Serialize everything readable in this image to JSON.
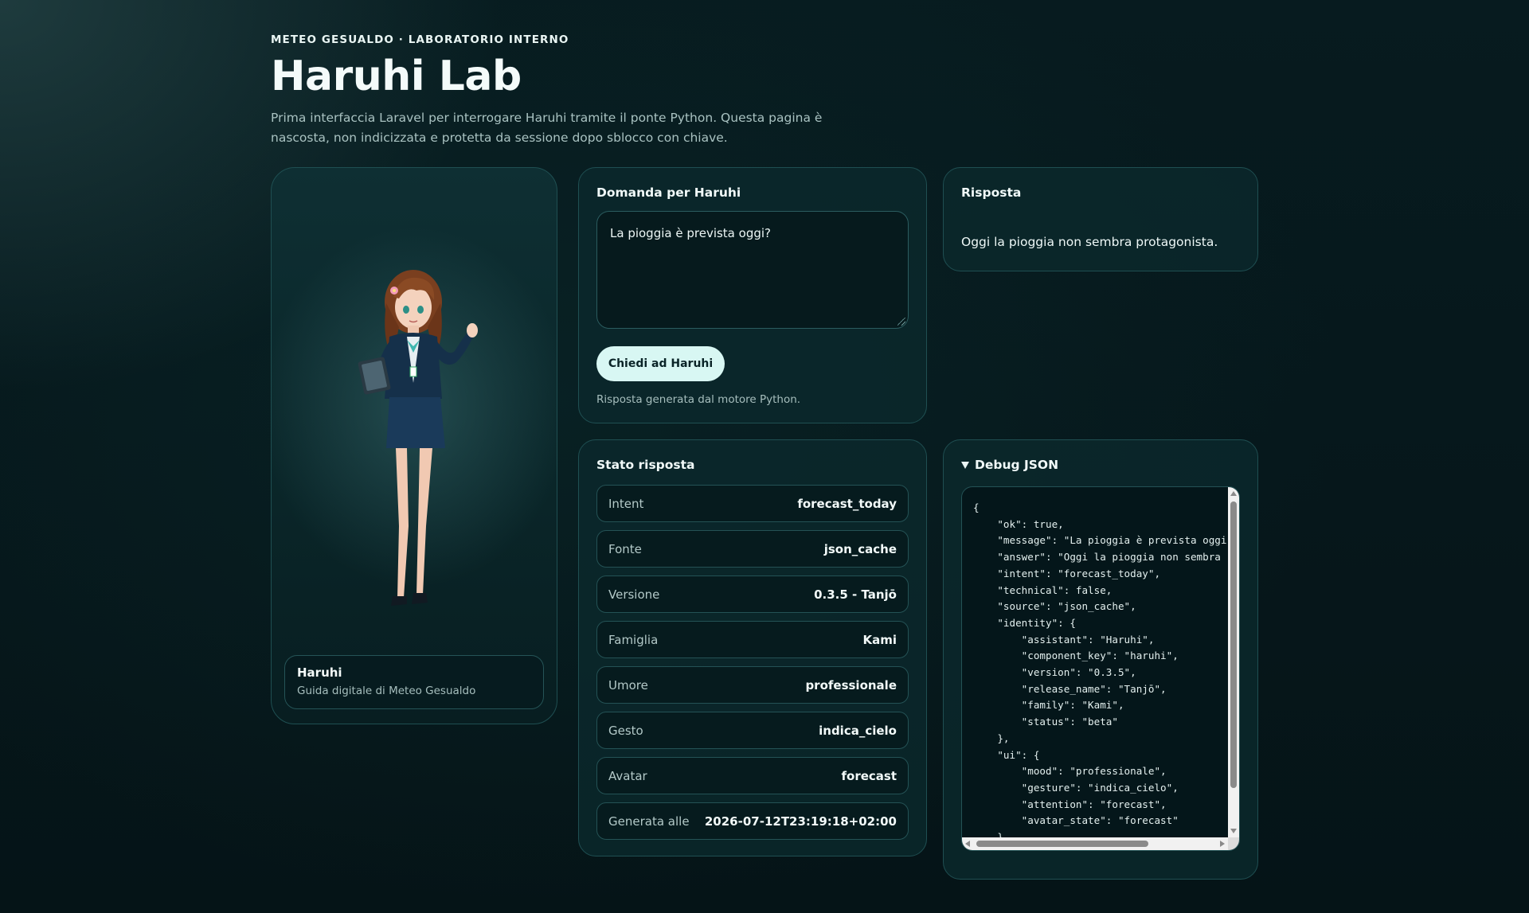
{
  "header": {
    "kicker": "METEO GESUALDO · LABORATORIO INTERNO",
    "title": "Haruhi Lab",
    "subtitle": "Prima interfaccia Laravel per interrogare Haruhi tramite il ponte Python. Questa pagina è nascosta, non indicizzata e protetta da sessione dopo sblocco con chiave."
  },
  "avatar": {
    "name": "Haruhi",
    "role": "Guida digitale di Meteo Gesualdo"
  },
  "question": {
    "title": "Domanda per Haruhi",
    "value": "La pioggia è prevista oggi?",
    "button": "Chiedi ad Haruhi",
    "note": "Risposta generata dal motore Python."
  },
  "answer": {
    "title": "Risposta",
    "text": "Oggi la pioggia non sembra protagonista."
  },
  "status": {
    "title": "Stato risposta",
    "rows": [
      {
        "key": "Intent",
        "value": "forecast_today"
      },
      {
        "key": "Fonte",
        "value": "json_cache"
      },
      {
        "key": "Versione",
        "value": "0.3.5 - Tanjō"
      },
      {
        "key": "Famiglia",
        "value": "Kami"
      },
      {
        "key": "Umore",
        "value": "professionale"
      },
      {
        "key": "Gesto",
        "value": "indica_cielo"
      },
      {
        "key": "Avatar",
        "value": "forecast"
      },
      {
        "key": "Generata alle",
        "value": "2026-07-12T23:19:18+02:00"
      }
    ]
  },
  "debug": {
    "title": "Debug JSON",
    "json_text": "{\n    \"ok\": true,\n    \"message\": \"La pioggia è prevista oggi\n    \"answer\": \"Oggi la pioggia non sembra\n    \"intent\": \"forecast_today\",\n    \"technical\": false,\n    \"source\": \"json_cache\",\n    \"identity\": {\n        \"assistant\": \"Haruhi\",\n        \"component_key\": \"haruhi\",\n        \"version\": \"0.3.5\",\n        \"release_name\": \"Tanjō\",\n        \"family\": \"Kami\",\n        \"status\": \"beta\"\n    },\n    \"ui\": {\n        \"mood\": \"professionale\",\n        \"gesture\": \"indica_cielo\",\n        \"attention\": \"forecast\",\n        \"avatar_state\": \"forecast\"\n    },"
  },
  "colors": {
    "background": "#06171b",
    "card": "#0a282c",
    "card_border": "#1f4f52",
    "button": "#d8f7f3",
    "text_muted": "#a6bebd"
  }
}
